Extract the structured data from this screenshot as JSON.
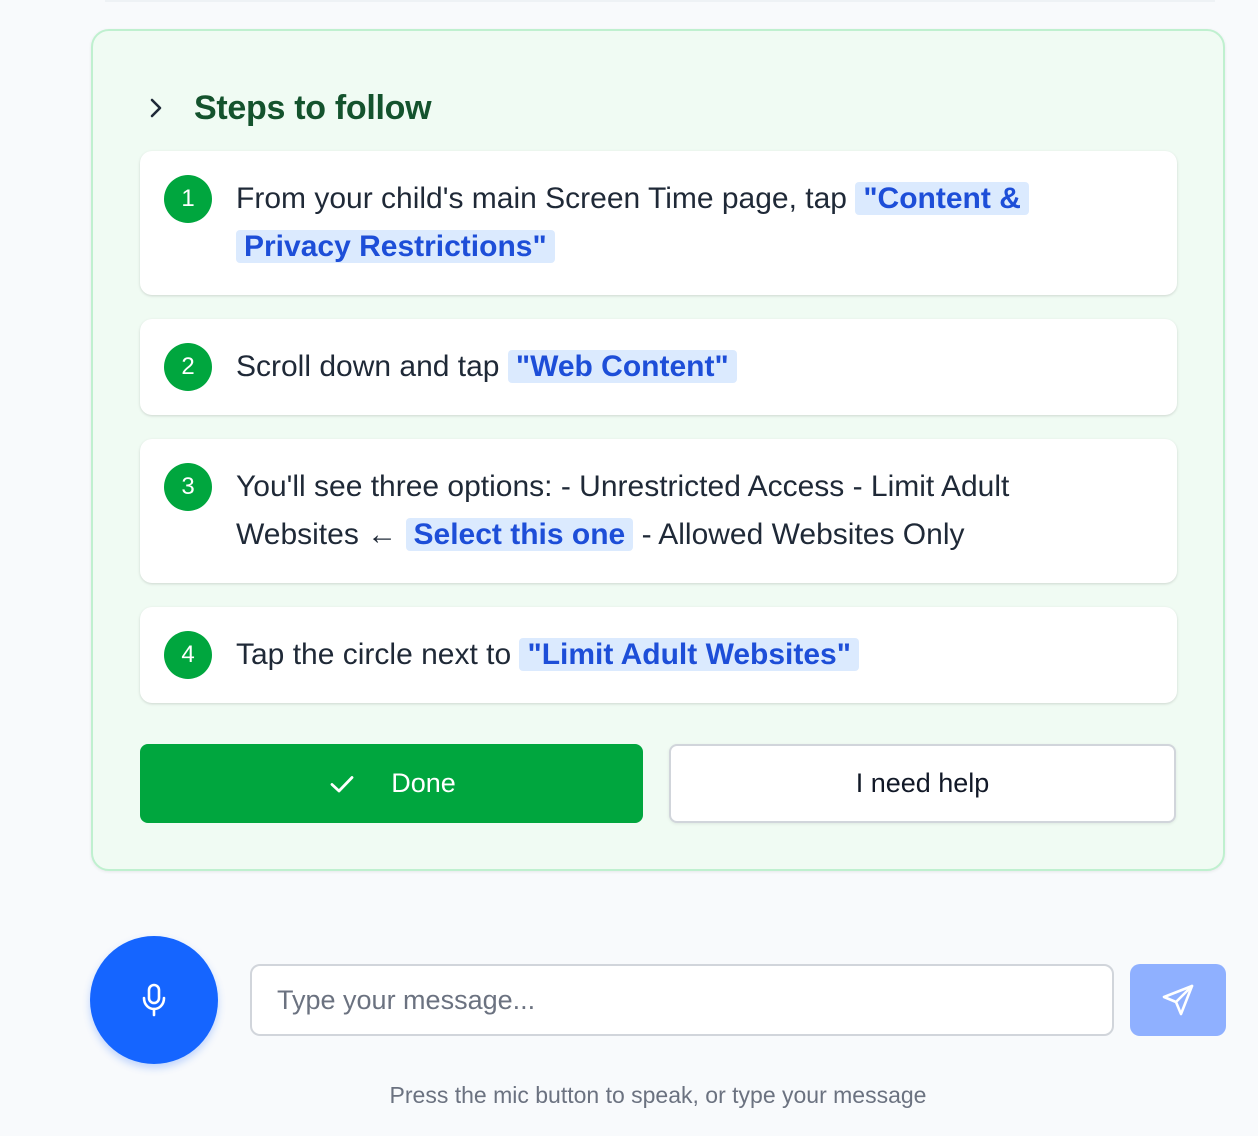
{
  "steps_panel": {
    "title": "Steps to follow",
    "steps": [
      {
        "number": "1",
        "text_before": "From your child's main Screen Time page, tap ",
        "highlight": "\"Content & Privacy Restrictions\"",
        "text_after": ""
      },
      {
        "number": "2",
        "text_before": "Scroll down and tap ",
        "highlight": "\"Web Content\"",
        "text_after": ""
      },
      {
        "number": "3",
        "text_before": "You'll see three options: - Unrestricted Access - Limit Adult Websites ← ",
        "highlight": "Select this one",
        "text_after": " - Allowed Websites Only"
      },
      {
        "number": "4",
        "text_before": "Tap the circle next to ",
        "highlight": "\"Limit Adult Websites\"",
        "text_after": ""
      }
    ],
    "done_label": "Done",
    "help_label": "I need help"
  },
  "composer": {
    "placeholder": "Type your message...",
    "value": "",
    "helper_text": "Press the mic button to speak, or type your message"
  },
  "icons": {
    "chevron": "chevron-right-icon",
    "done": "check-icon",
    "mic": "microphone-icon",
    "send": "send-icon"
  },
  "colors": {
    "primary_green": "#00a63e",
    "title_green": "#14532d",
    "highlight_bg": "#dbeafe",
    "highlight_text": "#1d4ed8",
    "mic_blue": "#1565ff",
    "send_disabled": "#8fb0ff"
  }
}
